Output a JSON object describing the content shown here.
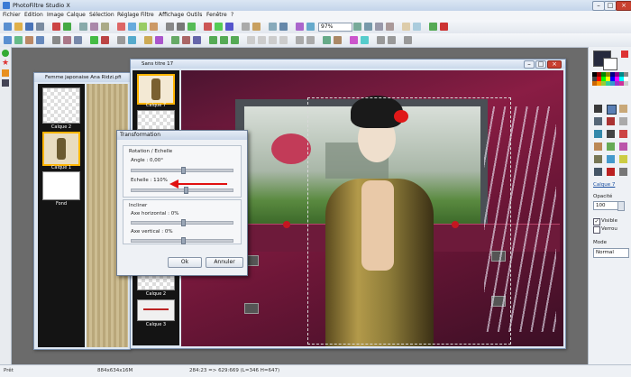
{
  "app": {
    "title": "PhotoFiltre Studio X"
  },
  "menu": [
    "Fichier",
    "Edition",
    "Image",
    "Calque",
    "Sélection",
    "Réglage",
    "Filtre",
    "Affichage",
    "Outils",
    "Fenêtre",
    "?"
  ],
  "toolbar": {
    "zoom": "97%"
  },
  "doc_left": {
    "title": "Femme japonaise Ana Ridzi.pfi",
    "layers": [
      {
        "label": "Calque 2"
      },
      {
        "label": "Calque 1"
      },
      {
        "label": "Fond"
      }
    ]
  },
  "doc_main": {
    "title": "Sans titre 17",
    "layers": [
      {
        "label": "Calque 7"
      },
      {
        "label": "Calque 2"
      },
      {
        "label": "Calque 3"
      }
    ]
  },
  "dialog": {
    "title": "Transformation",
    "group1_title": "Rotation / Echelle",
    "angle_label": "Angle : 0,00°",
    "scale_label": "Echelle : 110%",
    "group2_title": "Incliner",
    "axe_h_label": "Axe horizontal : 0%",
    "axe_v_label": "Axe vertical : 0%",
    "ok_label": "Ok",
    "cancel_label": "Annuler"
  },
  "rightpanel": {
    "layer_name": "Calque 7",
    "opacity_label": "Opacité",
    "opacity_value": "100",
    "visible_label": "Visible",
    "lock_label": "Verrou",
    "mode_label": "Mode",
    "mode_value": "Normal"
  },
  "status": {
    "left": "Prêt",
    "size": "884x634x16M",
    "coords": "284:23 => 629:669 (L=346  H=647)"
  },
  "colors": {
    "accent_arrow": "#e01010",
    "canvas_bg": "#8a1d44",
    "selection_border": "#ffb400"
  }
}
